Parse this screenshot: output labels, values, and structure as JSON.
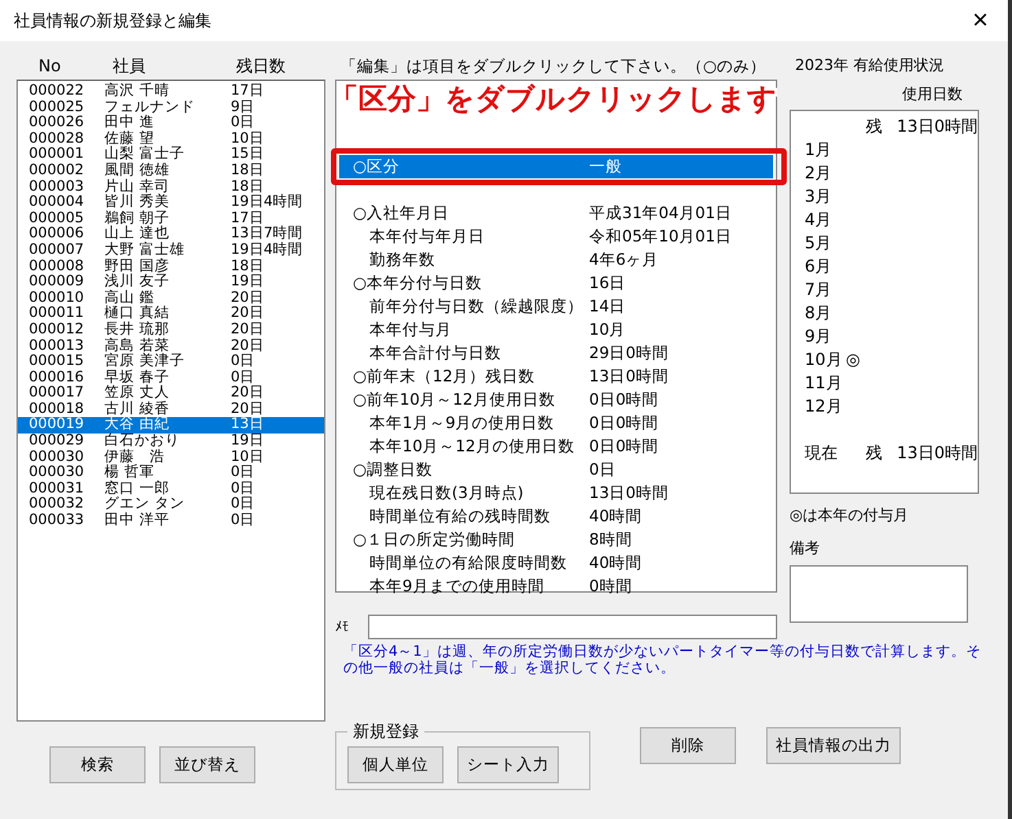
{
  "window": {
    "title": "社員情報の新規登録と編集",
    "close": "×"
  },
  "employees": {
    "columns": [
      "No",
      "社員",
      "残日数"
    ],
    "rows": [
      {
        "no": "000022",
        "name": "高沢 千晴",
        "days": "17日",
        "extra": "",
        "selected": false
      },
      {
        "no": "000025",
        "name": "フェルナンド",
        "days": "9日",
        "extra": "",
        "selected": false
      },
      {
        "no": "000026",
        "name": "田中 進",
        "days": "0日",
        "extra": "",
        "selected": false
      },
      {
        "no": "000028",
        "name": "佐藤 望",
        "days": "10日",
        "extra": "",
        "selected": false
      },
      {
        "no": "000001",
        "name": "山梨 富士子",
        "days": "15日",
        "extra": "",
        "selected": false
      },
      {
        "no": "000002",
        "name": "風間 徳雄",
        "days": "18日",
        "extra": "",
        "selected": false
      },
      {
        "no": "000003",
        "name": "片山 幸司",
        "days": "18日",
        "extra": "",
        "selected": false
      },
      {
        "no": "000004",
        "name": "皆川 秀美",
        "days": "19日",
        "extra": "4時間",
        "selected": false
      },
      {
        "no": "000005",
        "name": "鵜飼 朝子",
        "days": "17日",
        "extra": "",
        "selected": false
      },
      {
        "no": "000006",
        "name": "山上 達也",
        "days": "13日",
        "extra": "7時間",
        "selected": false
      },
      {
        "no": "000007",
        "name": "大野 富士雄",
        "days": "19日",
        "extra": "4時間",
        "selected": false
      },
      {
        "no": "000008",
        "name": "野田 国彦",
        "days": "18日",
        "extra": "",
        "selected": false
      },
      {
        "no": "000009",
        "name": "浅川 友子",
        "days": "19日",
        "extra": "",
        "selected": false
      },
      {
        "no": "000010",
        "name": "高山 鑑",
        "days": "20日",
        "extra": "",
        "selected": false
      },
      {
        "no": "000011",
        "name": "樋口 真結",
        "days": "20日",
        "extra": "",
        "selected": false
      },
      {
        "no": "000012",
        "name": "長井 琉那",
        "days": "20日",
        "extra": "",
        "selected": false
      },
      {
        "no": "000013",
        "name": "高島 若菜",
        "days": "20日",
        "extra": "",
        "selected": false
      },
      {
        "no": "000015",
        "name": "宮原 美津子",
        "days": "0日",
        "extra": "",
        "selected": false
      },
      {
        "no": "000016",
        "name": "早坂 春子",
        "days": "0日",
        "extra": "",
        "selected": false
      },
      {
        "no": "000017",
        "name": "笠原 丈人",
        "days": "20日",
        "extra": "",
        "selected": false
      },
      {
        "no": "000018",
        "name": "古川 綾香",
        "days": "20日",
        "extra": "",
        "selected": false
      },
      {
        "no": "000019",
        "name": "大谷 由紀",
        "days": "13日",
        "extra": "",
        "selected": true
      },
      {
        "no": "000029",
        "name": "白石かおり",
        "days": "19日",
        "extra": "",
        "selected": false
      },
      {
        "no": "000030",
        "name": "伊藤　浩",
        "days": "10日",
        "extra": "",
        "selected": false
      },
      {
        "no": "000030",
        "name": "楊 哲軍",
        "days": "0日",
        "extra": "",
        "selected": false
      },
      {
        "no": "000031",
        "name": "窓口 一郎",
        "days": "0日",
        "extra": "",
        "selected": false
      },
      {
        "no": "000032",
        "name": "グエン タン",
        "days": "0日",
        "extra": "",
        "selected": false
      },
      {
        "no": "000033",
        "name": "田中 洋平",
        "days": "0日",
        "extra": "",
        "selected": false
      }
    ]
  },
  "details": {
    "caption": "「編集」は項目をダブルクリックして下さい。（○のみ）",
    "rows": [
      {
        "label": "○区分",
        "value": "一般",
        "selected": true
      },
      {
        "label": "○入社年月日",
        "value": "平成31年04月01日",
        "selected": false
      },
      {
        "label": "　本年付与年月日",
        "value": "令和05年10月01日",
        "selected": false
      },
      {
        "label": "　勤務年数",
        "value": "4年6ヶ月",
        "selected": false
      },
      {
        "label": "○本年分付与日数",
        "value": "16日",
        "selected": false
      },
      {
        "label": "　前年分付与日数（繰越限度）",
        "value": "14日",
        "selected": false
      },
      {
        "label": "　本年付与月",
        "value": "10月",
        "selected": false
      },
      {
        "label": "　本年合計付与日数",
        "value": "29日0時間",
        "selected": false
      },
      {
        "label": "○前年末（12月）残日数",
        "value": "13日0時間",
        "selected": false
      },
      {
        "label": "○前年10月～12月使用日数",
        "value": "0日0時間",
        "selected": false
      },
      {
        "label": "　本年1月～9月の使用日数",
        "value": "0日0時間",
        "selected": false
      },
      {
        "label": "　本年10月～12月の使用日数",
        "value": "0日0時間",
        "selected": false
      },
      {
        "label": "○調整日数",
        "value": "0日",
        "selected": false
      },
      {
        "label": "　現在残日数(3月時点)",
        "value": "13日0時間",
        "selected": false
      },
      {
        "label": "　時間単位有給の残時間数",
        "value": "40時間",
        "selected": false
      },
      {
        "label": "○１日の所定労働時間",
        "value": "8時間",
        "selected": false
      },
      {
        "label": "　時間単位の有給限度時間数",
        "value": "40時間",
        "selected": false
      },
      {
        "label": "　本年9月までの使用時間",
        "value": "0時間",
        "selected": false
      }
    ]
  },
  "callout": "「区分」をダブルクリックします",
  "usage": {
    "title": "2023年 有給使用状況",
    "column": "使用日数",
    "rows": [
      {
        "month": "",
        "mark": "",
        "rest": "残",
        "amount": "13日0時間"
      },
      {
        "month": "1月",
        "mark": "",
        "rest": "",
        "amount": ""
      },
      {
        "month": "2月",
        "mark": "",
        "rest": "",
        "amount": ""
      },
      {
        "month": "3月",
        "mark": "",
        "rest": "",
        "amount": ""
      },
      {
        "month": "4月",
        "mark": "",
        "rest": "",
        "amount": ""
      },
      {
        "month": "5月",
        "mark": "",
        "rest": "",
        "amount": ""
      },
      {
        "month": "6月",
        "mark": "",
        "rest": "",
        "amount": ""
      },
      {
        "month": "7月",
        "mark": "",
        "rest": "",
        "amount": ""
      },
      {
        "month": "8月",
        "mark": "",
        "rest": "",
        "amount": ""
      },
      {
        "month": "9月",
        "mark": "",
        "rest": "",
        "amount": ""
      },
      {
        "month": "10月",
        "mark": "◎",
        "rest": "",
        "amount": ""
      },
      {
        "month": "11月",
        "mark": "",
        "rest": "",
        "amount": ""
      },
      {
        "month": "12月",
        "mark": "",
        "rest": "",
        "amount": ""
      },
      {
        "month": "",
        "mark": "",
        "rest": "",
        "amount": ""
      },
      {
        "month": "現在",
        "mark": "",
        "rest": "残",
        "amount": "13日0時間"
      }
    ],
    "legend": "◎は本年の付与月",
    "remarks_label": "備考"
  },
  "memo": {
    "label": "ﾒﾓ"
  },
  "note": "「区分4～1」は週、年の所定労働日数が少ないパートタイマー等の付与日数で計算します。その他一般の社員は「一般」を選択してください。",
  "buttons": {
    "search": "検索",
    "sort": "並び替え",
    "group": "新規登録",
    "individual": "個人単位",
    "sheet": "シート入力",
    "delete": "削除",
    "export": "社員情報の出力"
  }
}
